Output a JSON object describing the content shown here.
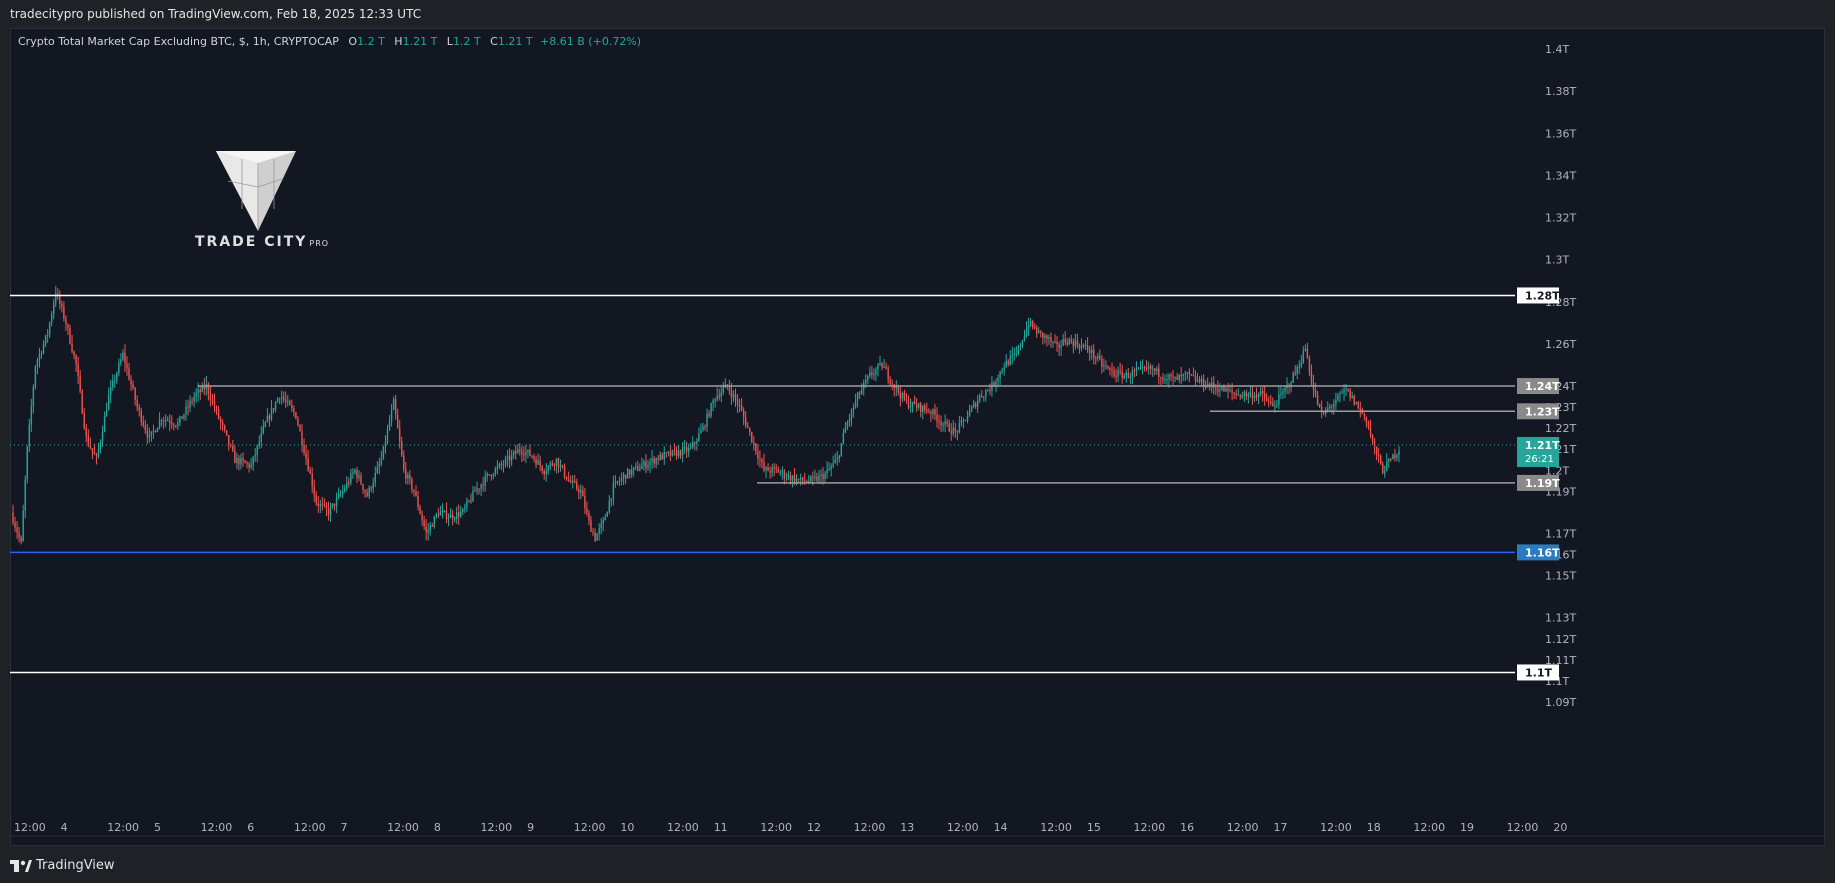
{
  "header": {
    "publisher_line": "tradecitypro published on TradingView.com, Feb 18, 2025 12:33 UTC"
  },
  "legend": {
    "title": "Crypto Total Market Cap Excluding BTC, $, 1h, CRYPTOCAP",
    "open_label": "O",
    "open": "1.2 T",
    "high_label": "H",
    "high": "1.21 T",
    "low_label": "L",
    "low": "1.2 T",
    "close_label": "C",
    "close": "1.21 T",
    "change": "+8.61 B (+0.72%)"
  },
  "logo": {
    "name": "TRADE CITY",
    "suffix": "PRO"
  },
  "footer": {
    "brand": "TradingView"
  },
  "colors": {
    "up": "#26a69a",
    "down": "#ef5350",
    "background": "#131722",
    "support_blue": "#2962ff"
  },
  "chart_data": {
    "type": "candlestick",
    "title": "Crypto Total Market Cap Excluding BTC, $, 1h, CRYPTOCAP",
    "ylim": [
      1.08,
      1.41
    ],
    "y_ticks": [
      "1.4T",
      "1.38T",
      "1.36T",
      "1.34T",
      "1.32T",
      "1.3T",
      "1.28T",
      "1.26T",
      "1.24T",
      "1.23T",
      "1.22T",
      "1.21T",
      "1.2T",
      "1.19T",
      "1.17T",
      "1.16T",
      "1.15T",
      "1.13T",
      "1.12T",
      "1.11T",
      "1.1T",
      "1.09T"
    ],
    "x_ticks": [
      "12:00",
      "4",
      "12:00",
      "5",
      "12:00",
      "6",
      "12:00",
      "7",
      "12:00",
      "8",
      "12:00",
      "9",
      "12:00",
      "10",
      "12:00",
      "11",
      "12:00",
      "12",
      "12:00",
      "13",
      "12:00",
      "14",
      "12:00",
      "15",
      "12:00",
      "16",
      "12:00",
      "17",
      "12:00",
      "18",
      "12:00",
      "19",
      "12:00",
      "20"
    ],
    "price_path": [
      [
        0,
        1.18
      ],
      [
        5,
        1.165
      ],
      [
        8,
        1.21
      ],
      [
        12,
        1.25
      ],
      [
        18,
        1.265
      ],
      [
        22,
        1.285
      ],
      [
        27,
        1.27
      ],
      [
        32,
        1.25
      ],
      [
        37,
        1.215
      ],
      [
        42,
        1.205
      ],
      [
        48,
        1.235
      ],
      [
        55,
        1.255
      ],
      [
        62,
        1.23
      ],
      [
        68,
        1.215
      ],
      [
        74,
        1.225
      ],
      [
        82,
        1.222
      ],
      [
        90,
        1.235
      ],
      [
        96,
        1.24
      ],
      [
        104,
        1.22
      ],
      [
        110,
        1.205
      ],
      [
        118,
        1.202
      ],
      [
        125,
        1.222
      ],
      [
        132,
        1.236
      ],
      [
        140,
        1.226
      ],
      [
        146,
        1.202
      ],
      [
        150,
        1.185
      ],
      [
        156,
        1.18
      ],
      [
        163,
        1.19
      ],
      [
        169,
        1.2
      ],
      [
        175,
        1.188
      ],
      [
        182,
        1.205
      ],
      [
        188,
        1.232
      ],
      [
        193,
        1.2
      ],
      [
        198,
        1.19
      ],
      [
        204,
        1.17
      ],
      [
        210,
        1.18
      ],
      [
        216,
        1.178
      ],
      [
        222,
        1.18
      ],
      [
        228,
        1.19
      ],
      [
        235,
        1.198
      ],
      [
        242,
        1.203
      ],
      [
        250,
        1.21
      ],
      [
        256,
        1.207
      ],
      [
        262,
        1.2
      ],
      [
        268,
        1.205
      ],
      [
        274,
        1.195
      ],
      [
        280,
        1.19
      ],
      [
        284,
        1.175
      ],
      [
        287,
        1.168
      ],
      [
        291,
        1.175
      ],
      [
        296,
        1.192
      ],
      [
        302,
        1.198
      ],
      [
        310,
        1.202
      ],
      [
        318,
        1.206
      ],
      [
        326,
        1.208
      ],
      [
        334,
        1.21
      ],
      [
        340,
        1.22
      ],
      [
        346,
        1.235
      ],
      [
        352,
        1.24
      ],
      [
        358,
        1.23
      ],
      [
        364,
        1.215
      ],
      [
        370,
        1.2
      ],
      [
        376,
        1.2
      ],
      [
        382,
        1.197
      ],
      [
        388,
        1.195
      ],
      [
        394,
        1.195
      ],
      [
        400,
        1.198
      ],
      [
        406,
        1.205
      ],
      [
        410,
        1.22
      ],
      [
        416,
        1.235
      ],
      [
        422,
        1.245
      ],
      [
        428,
        1.25
      ],
      [
        434,
        1.24
      ],
      [
        440,
        1.232
      ],
      [
        446,
        1.23
      ],
      [
        452,
        1.228
      ],
      [
        458,
        1.222
      ],
      [
        464,
        1.218
      ],
      [
        470,
        1.226
      ],
      [
        476,
        1.235
      ],
      [
        482,
        1.24
      ],
      [
        488,
        1.25
      ],
      [
        494,
        1.255
      ],
      [
        500,
        1.27
      ],
      [
        505,
        1.265
      ],
      [
        510,
        1.262
      ],
      [
        514,
        1.258
      ],
      [
        518,
        1.262
      ],
      [
        524,
        1.26
      ],
      [
        530,
        1.257
      ],
      [
        536,
        1.25
      ],
      [
        542,
        1.246
      ],
      [
        548,
        1.245
      ],
      [
        554,
        1.247
      ],
      [
        560,
        1.248
      ],
      [
        566,
        1.245
      ],
      [
        572,
        1.243
      ],
      [
        578,
        1.245
      ],
      [
        584,
        1.242
      ],
      [
        590,
        1.24
      ],
      [
        596,
        1.238
      ],
      [
        602,
        1.236
      ],
      [
        608,
        1.236
      ],
      [
        614,
        1.236
      ],
      [
        620,
        1.23
      ],
      [
        626,
        1.238
      ],
      [
        632,
        1.248
      ],
      [
        636,
        1.258
      ],
      [
        640,
        1.238
      ],
      [
        644,
        1.226
      ],
      [
        650,
        1.232
      ],
      [
        656,
        1.238
      ],
      [
        662,
        1.23
      ],
      [
        666,
        1.224
      ],
      [
        670,
        1.21
      ],
      [
        674,
        1.2
      ],
      [
        678,
        1.205
      ],
      [
        682,
        1.21
      ]
    ],
    "levels": [
      {
        "value": 1.283,
        "label": "1.28T",
        "style": "white-full"
      },
      {
        "value": 1.24,
        "label": "1.24T",
        "style": "gray-partial",
        "from_frac": 0.125
      },
      {
        "value": 1.228,
        "label": "1.23T",
        "style": "gray-partial",
        "from_frac": 0.8
      },
      {
        "value": 1.194,
        "label": "1.19T",
        "style": "gray-partial",
        "from_frac": 0.498
      },
      {
        "value": 1.161,
        "label": "1.16T",
        "style": "blue-full"
      },
      {
        "value": 1.104,
        "label": "1.1T",
        "style": "white-full"
      }
    ],
    "last_price": {
      "value": 1.212,
      "label": "1.21T",
      "countdown": "26:21"
    }
  }
}
